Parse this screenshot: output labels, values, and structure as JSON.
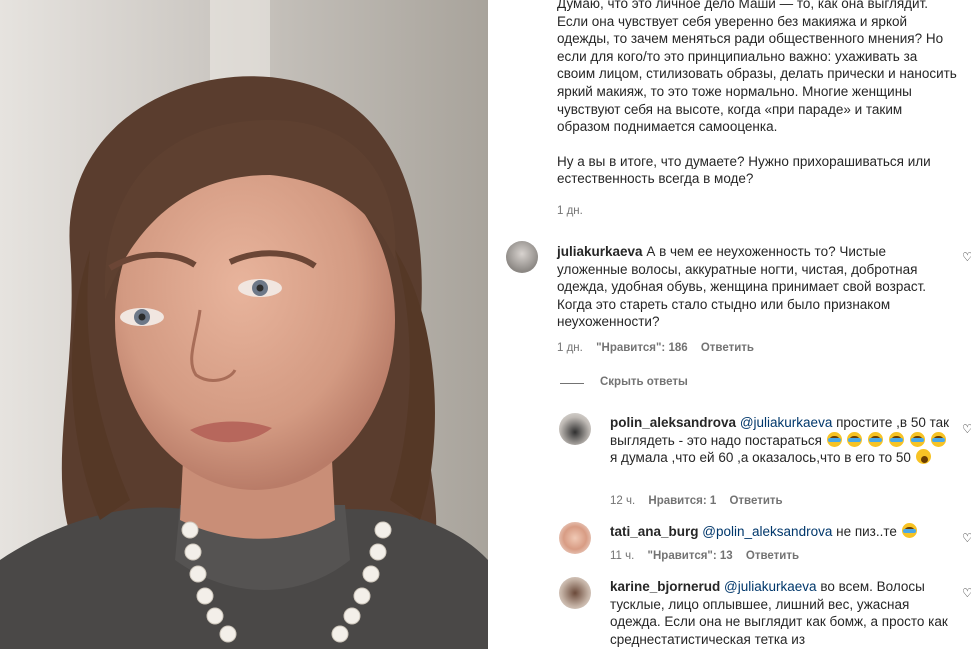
{
  "post": {
    "caption": "Думаю, что это личное дело Маши — то, как она выглядит. Если она чувствует себя уверенно без макияжа и яркой одежды, то зачем меняться ради общественного мнения? Но если для кого/то это принципиально важно: ухаживать за своим лицом, стилизовать образы, делать прически и наносить яркий макияж, то это тоже нормально. Многие женщины чувствуют себя на высоте, когда «при параде» и таким образом поднимается самооценка.",
    "question": "Ну а вы в итоге, что думаете? Нужно прихорашиваться или естественность всегда в моде?",
    "time": "1 дн."
  },
  "comments": [
    {
      "username": "juliakurkaeva",
      "text": "А в чем ее неухоженность то? Чистые уложенные волосы, аккуратные ногти, чистая, добротная одежда, удобная обувь, женщина принимает свой возраст. Когда это стареть стало стыдно или было признаком неухоженности?",
      "time": "1 дн.",
      "likes": "\"Нравится\": 186",
      "reply_label": "Ответить",
      "hide_replies": "Скрыть ответы"
    }
  ],
  "replies": [
    {
      "username": "polin_aleksandrova",
      "mention": "@juliakurkaeva",
      "text_a": "простите ,в 50 так выглядеть - это надо постараться",
      "text_b": "я думала ,что ей 60 ,а оказалось,что в его то 50",
      "time": "12 ч.",
      "likes": "Нравится: 1",
      "reply_label": "Ответить"
    },
    {
      "username": "tati_ana_burg",
      "mention": "@polin_aleksandrova",
      "text_a": "не пиз..те",
      "time": "11 ч.",
      "likes": "\"Нравится\": 13",
      "reply_label": "Ответить"
    },
    {
      "username": "karine_bjornerud",
      "mention": "@juliakurkaeva",
      "text_a": "во всем. Волосы тусклые, лицо оплывшее, лишний вес, ужасная одежда. Если она не выглядит как бомж, а просто как среднестатистическая тетка из"
    }
  ],
  "icons": {
    "heart": "heart-icon",
    "emoji": "laughing-crying-emoji"
  },
  "colors": {
    "mention": "#00376b",
    "meta": "#737373",
    "text": "#262626"
  }
}
